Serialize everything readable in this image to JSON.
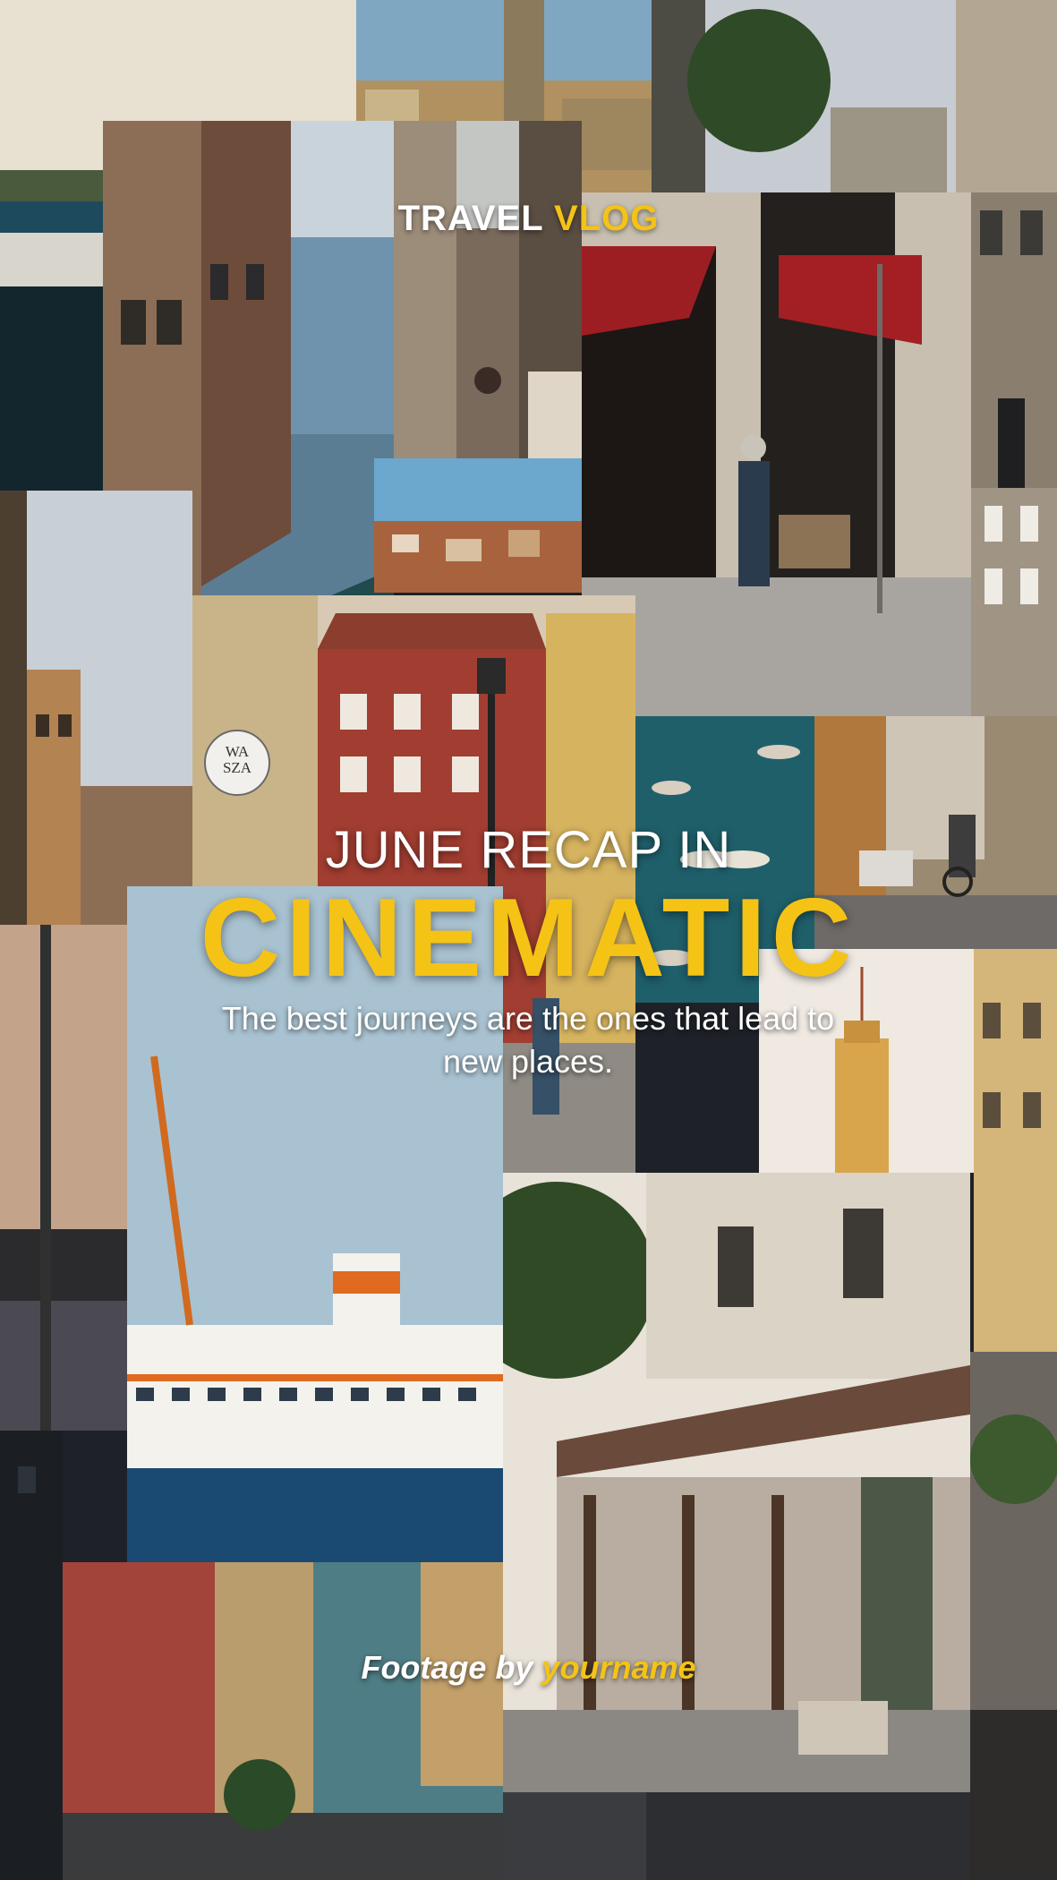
{
  "brand": {
    "word1": "TRAVEL",
    "word2": "VLOG"
  },
  "headline": "JUNE RECAP IN",
  "highlight": "CINEMATIC",
  "subtitle": "The best journeys are the ones that lead to new places.",
  "credit": {
    "prefix": "Footage by",
    "name": "yourname"
  },
  "sign": {
    "line1": "WA",
    "line2": "SZA"
  },
  "colors": {
    "accent": "#f4c316",
    "text": "#ffffff"
  }
}
